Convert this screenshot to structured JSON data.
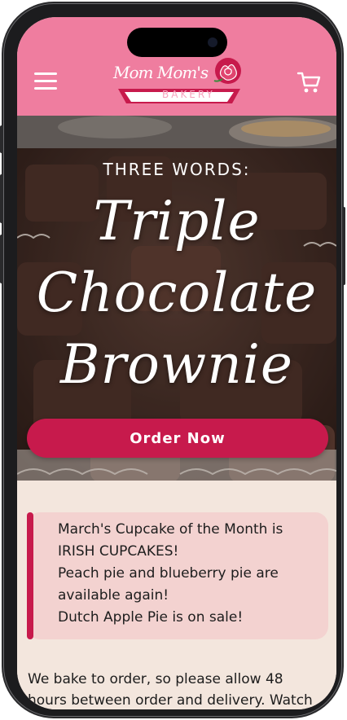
{
  "header": {
    "logo_script": "Mom Mom's",
    "logo_word": "BAKERY",
    "menu_icon": "hamburger-menu-icon",
    "cart_icon": "shopping-cart-icon"
  },
  "hero": {
    "kicker": "THREE WORDS:",
    "title_lines": [
      "Triple",
      "Chocolate",
      "Brownie"
    ],
    "cta": "Order Now"
  },
  "announcements": [
    "March's Cupcake of the Month is",
    "IRISH CUPCAKES!",
    "Peach pie and blueberry pie are",
    "available again!",
    "Dutch Apple Pie is on sale!"
  ],
  "intro_lines": [
    "We bake to order, so please allow 48",
    "hours between order and delivery. Watch"
  ],
  "colors": {
    "header_pink": "#ef7d9f",
    "accent": "#c71a4c",
    "page_bg": "#f3e6dd",
    "notice_bg": "#f3d2d0"
  }
}
